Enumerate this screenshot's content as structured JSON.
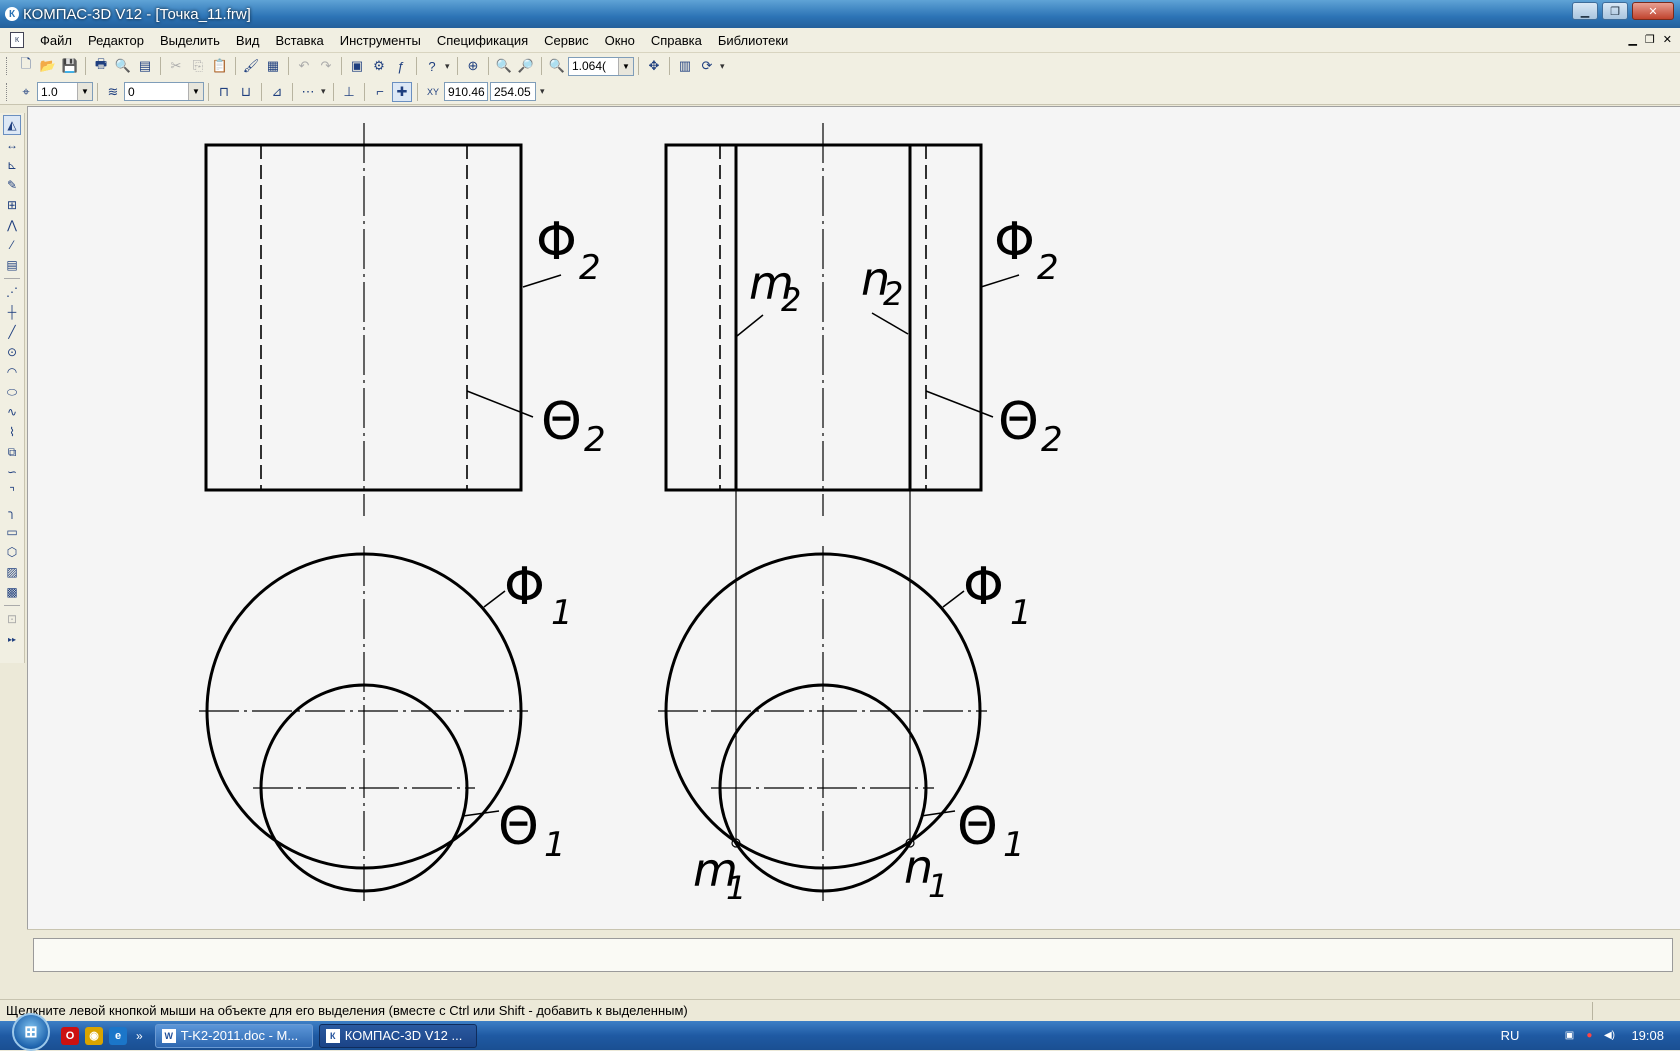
{
  "window": {
    "title": "КОМПАС-3D V12 - [Точка_11.frw]",
    "app_icon": "kompas-icon",
    "controls": [
      "minimize",
      "restore",
      "close"
    ]
  },
  "menu": {
    "items": [
      "Файл",
      "Редактор",
      "Выделить",
      "Вид",
      "Вставка",
      "Инструменты",
      "Спецификация",
      "Сервис",
      "Окно",
      "Справка",
      "Библиотеки"
    ]
  },
  "toolbar_view": {
    "zoom_value": "1.064("
  },
  "toolbar_current_state": {
    "step_value": "1.0",
    "layer_value": "0",
    "coord_x": "910.46",
    "coord_y": "254.05"
  },
  "drawing": {
    "labels": {
      "phi2_left": "Φ",
      "phi2_left_sub": "2",
      "theta2_left": "Θ",
      "theta2_left_sub": "2",
      "phi1_left": "Φ",
      "phi1_left_sub": "1",
      "theta1_left": "Θ",
      "theta1_left_sub": "1",
      "phi2_right": "Φ",
      "phi2_right_sub": "2",
      "theta2_right": "Θ",
      "theta2_right_sub": "2",
      "m2": "m",
      "m2_sub": "2",
      "n2": "n",
      "n2_sub": "2",
      "phi1_right": "Φ",
      "phi1_right_sub": "1",
      "theta1_right": "Θ",
      "theta1_right_sub": "1",
      "m1": "m",
      "m1_sub": "1",
      "n1": "n",
      "n1_sub": "1"
    }
  },
  "status": {
    "hint": "Щелкните левой кнопкой мыши на объекте для его выделения (вместе с Ctrl или Shift - добавить к выделенным)"
  },
  "taskbar": {
    "tasks": [
      {
        "label": "T-K2-2011.doc - M...",
        "icon": "word-icon"
      },
      {
        "label": "КОМПАС-3D V12 ...",
        "icon": "kompas-icon"
      }
    ],
    "quick_more": "»",
    "language": "RU",
    "clock": "19:08"
  }
}
